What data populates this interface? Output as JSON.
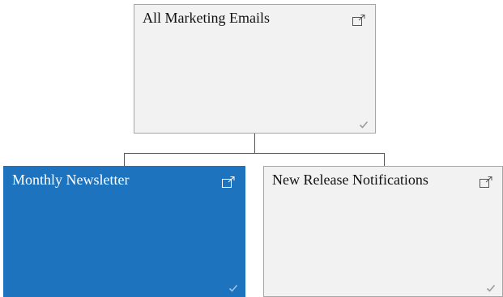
{
  "tree": {
    "root": {
      "label": "All Marketing Emails",
      "open_icon": "open-in-new-icon",
      "status_icon": "checkmark-icon"
    },
    "children": [
      {
        "label": "Monthly Newsletter",
        "selected": true,
        "open_icon": "open-in-new-icon",
        "status_icon": "checkmark-icon"
      },
      {
        "label": "New Release Notifications",
        "selected": false,
        "open_icon": "open-in-new-icon",
        "status_icon": "checkmark-icon"
      }
    ]
  },
  "colors": {
    "node_background": "#f2f2f2",
    "node_border": "#a6a6a6",
    "selected_background": "#1e73be",
    "connector": "#555555",
    "checkmark": "#9a9a9a"
  }
}
